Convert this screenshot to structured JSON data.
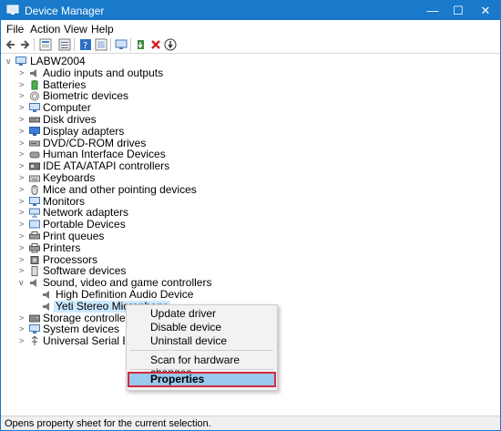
{
  "window": {
    "title": "Device Manager",
    "controls": {
      "minimize": "—",
      "maximize": "☐",
      "close": "✕"
    }
  },
  "menubar": [
    "File",
    "Action",
    "View",
    "Help"
  ],
  "toolbar": {
    "icons": [
      "back-icon",
      "forward-icon",
      "properties-view-icon",
      "show-hidden-icon",
      "help-icon",
      "device-properties-icon",
      "scan-hardware-icon",
      "update-driver-icon",
      "uninstall-icon",
      "disable-icon"
    ]
  },
  "tree": {
    "root": "LABW2004",
    "categories": [
      "Audio inputs and outputs",
      "Batteries",
      "Biometric devices",
      "Computer",
      "Disk drives",
      "Display adapters",
      "DVD/CD-ROM drives",
      "Human Interface Devices",
      "IDE ATA/ATAPI controllers",
      "Keyboards",
      "Mice and other pointing devices",
      "Monitors",
      "Network adapters",
      "Portable Devices",
      "Print queues",
      "Printers",
      "Processors",
      "Software devices",
      "Sound, video and game controllers"
    ],
    "sound_children": [
      "High Definition Audio Device",
      "Yeti Stereo Microphone"
    ],
    "after_categories": [
      "Storage controllers",
      "System devices",
      "Universal Serial Bus contro"
    ]
  },
  "context_menu": {
    "update_driver": "Update driver",
    "disable_device": "Disable device",
    "uninstall_device": "Uninstall device",
    "scan_hardware": "Scan for hardware changes",
    "properties": "Properties"
  },
  "statusbar": {
    "text": "Opens property sheet for the current selection."
  },
  "colors": {
    "titlebar": "#1979ca",
    "highlight": "#99c9ef",
    "callout_border": "#d32a3a"
  }
}
